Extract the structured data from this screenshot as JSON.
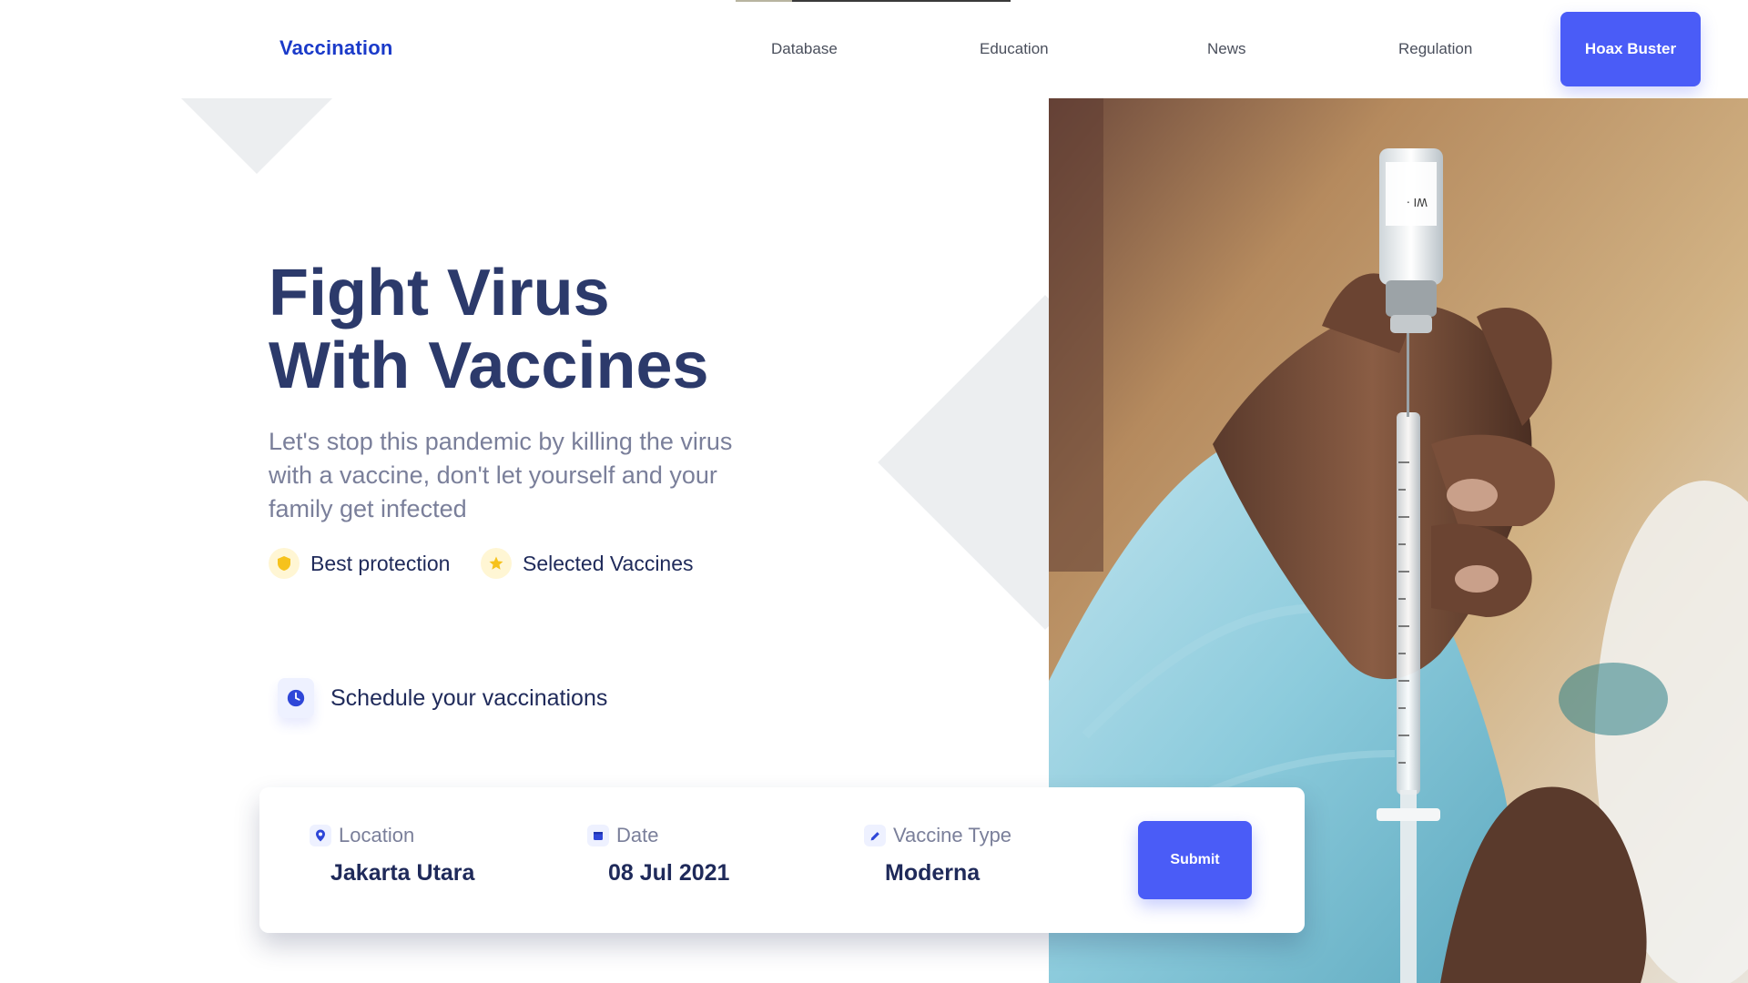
{
  "header": {
    "brand": "Vaccination",
    "nav": [
      {
        "label": "Database"
      },
      {
        "label": "Education"
      },
      {
        "label": "News"
      },
      {
        "label": "Regulation"
      }
    ],
    "cta_label": "Hoax Buster"
  },
  "hero": {
    "headline_line1": "Fight Virus",
    "headline_line2": "With Vaccines",
    "subtext": "Let's stop this pandemic by killing the virus with a vaccine, don't let yourself and your family get infected",
    "features": [
      {
        "icon": "shield-icon",
        "label": "Best protection"
      },
      {
        "icon": "star-icon",
        "label": "Selected Vaccines"
      }
    ],
    "schedule_label": "Schedule your vaccinations"
  },
  "booking": {
    "location_label": "Location",
    "location_value": "Jakarta Utara",
    "date_label": "Date",
    "date_value": "08 Jul 2021",
    "vaccine_type_label": "Vaccine Type",
    "vaccine_type_value": "Moderna",
    "submit_label": "Submit"
  },
  "photo": {
    "vial_text": "WI ·"
  },
  "colors": {
    "brand": "#1a3ac9",
    "accent": "#4a5cf7",
    "headline": "#2c3a6b",
    "body_text": "#7a7f9a",
    "decor_gray": "#eceef0",
    "feature_icon": "#f6c21c"
  }
}
